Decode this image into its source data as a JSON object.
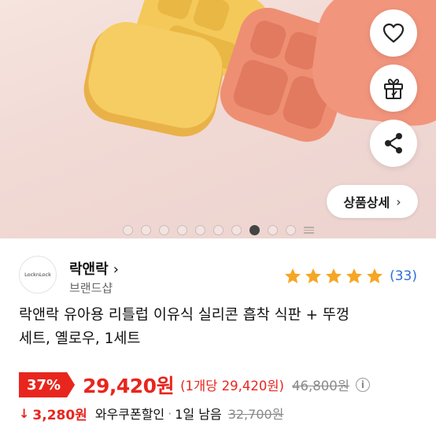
{
  "hero": {
    "detail_button_label": "상품상세",
    "slides_total": 10,
    "slide_active_index": 7
  },
  "brand": {
    "logo_text": "LocknLock",
    "name": "락앤락",
    "shop_label": "브랜드샵"
  },
  "rating": {
    "stars": 5,
    "review_count": "(33)",
    "star_color": "#f5a623"
  },
  "product": {
    "title_line1": "락앤락 유아용 리틀럽 이유식 실리콘 흡착 식판 + 뚜껑",
    "title_line2": "세트, 옐로우, 1세트"
  },
  "price": {
    "discount": "37%",
    "sale": "29,420원",
    "unit": "(1개당 29,420원)",
    "original": "46,800원"
  },
  "coupon": {
    "amount": "3,280원",
    "label": "와우쿠폰할인",
    "separator": "·",
    "remaining": "1일 남음",
    "original": "32,700원"
  },
  "colors": {
    "accent": "#e8261e",
    "link": "#2d6fd6"
  },
  "icons": [
    "heart-icon",
    "gift-icon",
    "share-icon",
    "chevron-right-icon",
    "star-icon",
    "info-icon",
    "down-arrow-icon"
  ]
}
